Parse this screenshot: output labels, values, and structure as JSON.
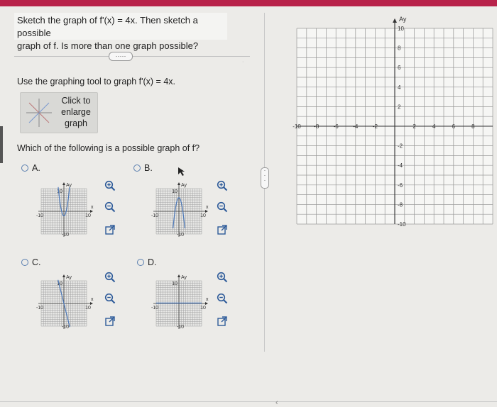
{
  "question": {
    "line1": "Sketch the graph of f'(x) = 4x. Then sketch a possible",
    "line2": "graph of f. Is more than one graph possible?"
  },
  "more_label": "·····",
  "instruction": "Use the graphing tool to graph f'(x) = 4x.",
  "enlarge": {
    "line1": "Click to",
    "line2": "enlarge",
    "line3": "graph"
  },
  "which_question": "Which of the following is a possible graph of f?",
  "options": [
    {
      "letter": "A.",
      "shape": "parabola"
    },
    {
      "letter": "B.",
      "shape": "inverted-parabola"
    },
    {
      "letter": "C.",
      "shape": "decreasing-line"
    },
    {
      "letter": "D.",
      "shape": "flat-line"
    }
  ],
  "thumb_labels": {
    "y": "Ay",
    "top": "10",
    "left": "-10",
    "right": "10",
    "bottom": "-10",
    "x": "x"
  },
  "graph": {
    "y_axis_label": "Ay",
    "x_ticks": [
      "-10",
      "-8",
      "-6",
      "-4",
      "-2",
      "2",
      "4",
      "6",
      "8"
    ],
    "y_ticks_pos": [
      "10",
      "8",
      "6",
      "4",
      "2"
    ],
    "y_ticks_neg": [
      "-2",
      "-4",
      "-6",
      "-8",
      "-10"
    ]
  }
}
